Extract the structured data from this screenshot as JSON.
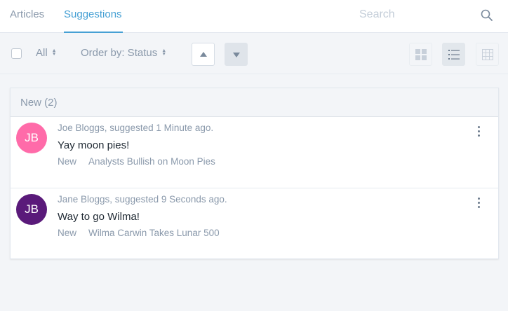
{
  "tabs": [
    {
      "label": "Articles",
      "active": false
    },
    {
      "label": "Suggestions",
      "active": true
    }
  ],
  "search": {
    "placeholder": "Search",
    "icon": "search-icon"
  },
  "toolbar": {
    "filter_label": "All",
    "order_label": "Order by: Status",
    "sort_up_icon": "triangle-up-icon",
    "sort_down_icon": "triangle-down-icon",
    "views": [
      {
        "icon": "grid-view-icon",
        "active": false
      },
      {
        "icon": "list-view-icon",
        "active": true
      },
      {
        "icon": "table-view-icon",
        "active": false
      }
    ]
  },
  "panel": {
    "header": "New (2)",
    "items": [
      {
        "initials": "JB",
        "avatar_color": "#ff6ba9",
        "meta": "Joe Bloggs, suggested 1 Minute ago.",
        "title": "Yay moon pies!",
        "status": "New",
        "article": "Analysts Bullish on Moon Pies"
      },
      {
        "initials": "JB",
        "avatar_color": "#5a1a7a",
        "meta": "Jane Bloggs, suggested 9 Seconds ago.",
        "title": "Way to go Wilma!",
        "status": "New",
        "article": "Wilma Carwin Takes Lunar 500"
      }
    ]
  },
  "colors": {
    "accent": "#46a0d4",
    "muted": "#8a99ab",
    "background": "#f3f5f8"
  }
}
